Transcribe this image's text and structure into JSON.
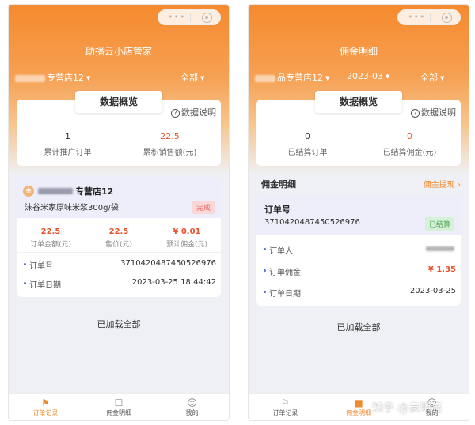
{
  "screen1": {
    "title": "助播云小店管家",
    "store_filter": "专营店12",
    "scope_filter": "全部",
    "overview": {
      "title": "数据概览",
      "help": "数据说明",
      "stats": [
        {
          "value": "1",
          "label": "累计推广订单"
        },
        {
          "value": "22.5",
          "label": "累积销售额(元)"
        }
      ]
    },
    "order": {
      "shop": "专营店12",
      "product": "沫谷米家原味米浆300g/袋",
      "status": "完成",
      "prices": [
        {
          "value": "22.5",
          "label": "订单金额(元)"
        },
        {
          "value": "22.5",
          "label": "售价(元)"
        },
        {
          "value": "¥ 0.01",
          "label": "预计佣金(元)"
        }
      ],
      "rows": [
        {
          "key": "订单号",
          "value": "3710420487450526976"
        },
        {
          "key": "订单日期",
          "value": "2023-03-25 18:44:42"
        }
      ]
    },
    "loaded_text": "已加载全部",
    "tabs": [
      "订单记录",
      "佣金明细",
      "我的"
    ]
  },
  "screen2": {
    "title": "佣金明细",
    "store_filter": "品专营店12",
    "month_filter": "2023-03",
    "scope_filter": "全部",
    "overview": {
      "title": "数据概览",
      "help": "数据说明",
      "stats": [
        {
          "value": "0",
          "label": "已结算订单"
        },
        {
          "value": "0",
          "label": "已结算佣金(元)"
        }
      ]
    },
    "section_title": "佣金明细",
    "withdraw_link": "佣金提现 ›",
    "detail": {
      "title": "订单号",
      "order_no": "3710420487450526976",
      "status": "已结算",
      "rows": [
        {
          "key": "订单人",
          "value": ""
        },
        {
          "key": "订单佣金",
          "value": "¥ 1.35"
        },
        {
          "key": "订单日期",
          "value": "2023-03-25"
        }
      ]
    },
    "loaded_text": "已加载全部",
    "tabs": [
      "订单记录",
      "佣金明细",
      "我的"
    ]
  },
  "watermark": "知乎 @袁明亮",
  "colors": {
    "accent": "#f08a2e",
    "price_red": "#e8542e",
    "header_orange": "#f58a2e"
  }
}
